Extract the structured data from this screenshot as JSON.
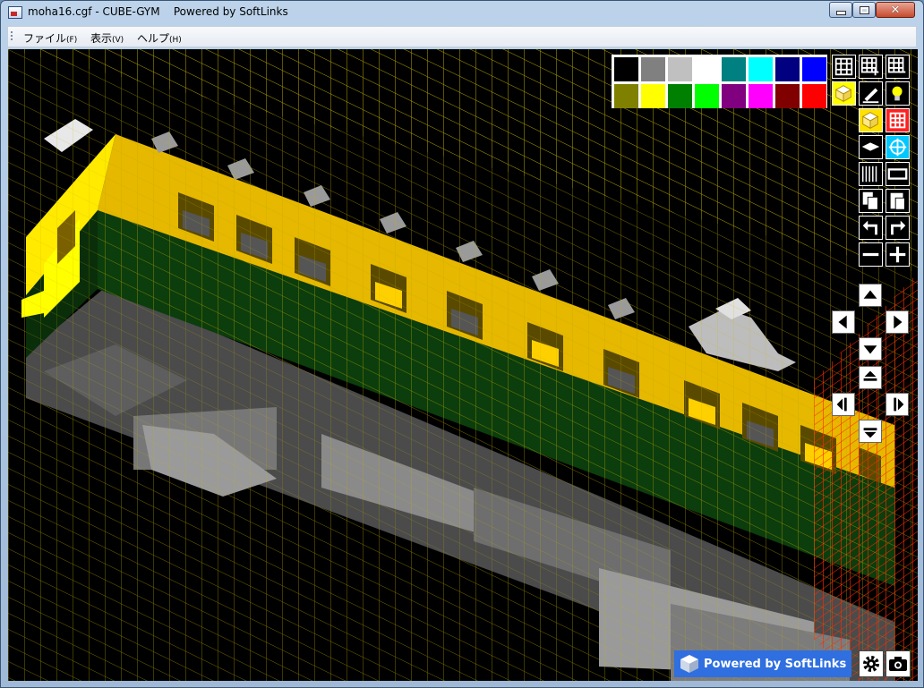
{
  "window": {
    "title": "moha16.cgf - CUBE-GYM    Powered by SoftLinks",
    "min_icon": "minimize-icon",
    "max_icon": "maximize-icon",
    "close_glyph": "✕"
  },
  "menu": [
    {
      "label": "ファイル",
      "accel": "(F)"
    },
    {
      "label": "表示",
      "accel": "(V)"
    },
    {
      "label": "ヘルプ",
      "accel": "(H)"
    }
  ],
  "palette": {
    "colors": [
      "#000000",
      "#808080",
      "#c0c0c0",
      "#ffffff",
      "#008080",
      "#00ffff",
      "#000080",
      "#0000ff",
      "#808000",
      "#ffff00",
      "#008000",
      "#00ff00",
      "#800080",
      "#ff00ff",
      "#800000",
      "#ff0000"
    ]
  },
  "tools": [
    {
      "icon": "grid-plane-icon"
    },
    {
      "icon": "grid-add-icon"
    },
    {
      "icon": "grid-remove-icon"
    },
    {
      "icon": "cube-draw-icon"
    },
    {
      "icon": "pencil-icon"
    },
    {
      "icon": "lightbulb-icon"
    },
    {
      "icon": "cube-select-icon"
    },
    {
      "icon": "grid-red-icon"
    },
    {
      "icon": "plane-icon"
    },
    {
      "icon": "crosshair-icon"
    },
    {
      "icon": "slice-icon"
    },
    {
      "icon": "frame-icon"
    },
    {
      "icon": "copy-icon"
    },
    {
      "icon": "paste-icon"
    },
    {
      "icon": "undo-icon"
    },
    {
      "icon": "redo-icon"
    },
    {
      "icon": "zoom-out-icon"
    },
    {
      "icon": "zoom-in-icon"
    }
  ],
  "navigation": {
    "move": [
      "pan-up-icon",
      "pan-left-icon",
      "pan-right-icon",
      "pan-down-icon"
    ],
    "rotate": [
      "rotate-up-icon",
      "rotate-left-icon",
      "rotate-right-icon",
      "rotate-down-icon"
    ]
  },
  "brand": {
    "text": "Powered by SoftLinks",
    "icon": "softlinks-cube-icon"
  },
  "corner_buttons": [
    {
      "icon": "settings-gear-icon"
    },
    {
      "icon": "camera-icon"
    }
  ],
  "colors": {
    "grid": "#c8b400",
    "model_yellow": "#e6b800",
    "model_green": "#0c3d0c",
    "model_gray": "#6a6a6a",
    "red_grid": "#ff2a00",
    "brand_blue": "#2f6fe0"
  }
}
